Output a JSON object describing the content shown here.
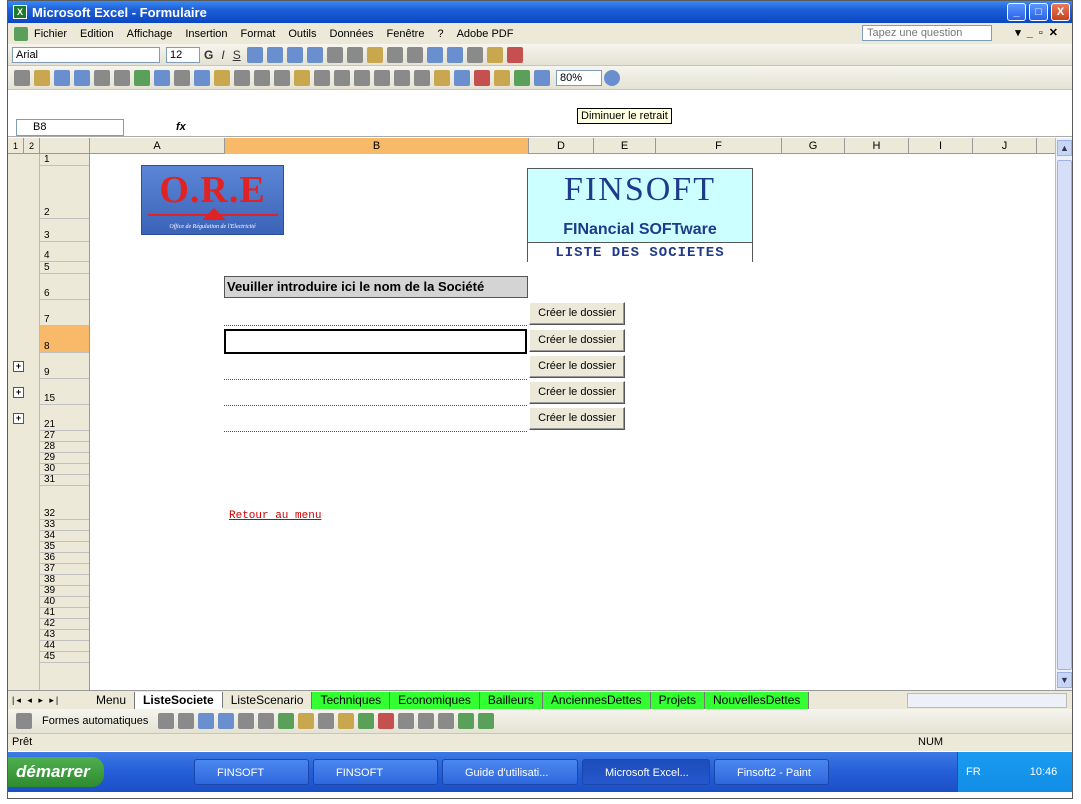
{
  "window": {
    "title": "Microsoft Excel - Formulaire",
    "min": "_",
    "max": "□",
    "close": "X"
  },
  "menu": {
    "items": [
      "Fichier",
      "Edition",
      "Affichage",
      "Insertion",
      "Format",
      "Outils",
      "Données",
      "Fenêtre",
      "?",
      "Adobe PDF"
    ],
    "question": "Tapez une question"
  },
  "format_toolbar": {
    "font": "Arial",
    "size": "12"
  },
  "std_toolbar": {
    "zoom": "80%"
  },
  "tooltip": "Diminuer le retrait",
  "formula_bar": {
    "cell": "B8",
    "fx": "fx"
  },
  "columns": [
    "A",
    "B",
    "D",
    "E",
    "F",
    "G",
    "H",
    "I",
    "J"
  ],
  "rows": [
    "1",
    "2",
    "3",
    "4",
    "5",
    "6",
    "7",
    "8",
    "9",
    "15",
    "21",
    "27",
    "28",
    "29",
    "30",
    "31",
    "32",
    "33",
    "34",
    "35",
    "36",
    "37",
    "38",
    "39",
    "40",
    "41",
    "42",
    "43",
    "44",
    "45"
  ],
  "outline": {
    "levels": [
      "1",
      "2"
    ],
    "plus": "+"
  },
  "logo": {
    "text": "O.R.E",
    "subtitle": "Office de Régulation de l'Electricité"
  },
  "finsoft": {
    "title": "FINSOFT",
    "subtitle": "FINancial SOFTware",
    "list": "LISTE DES SOCIETES"
  },
  "form": {
    "label": "Veuiller introduire ici le nom de la Société",
    "button": "Créer le dossier",
    "link": "Retour au menu"
  },
  "sheets": [
    "Menu",
    "ListeSociete",
    "ListeScenario",
    "Techniques",
    "Economiques",
    "Bailleurs",
    "AnciennesDettes",
    "Projets",
    "NouvellesDettes"
  ],
  "drawbar": {
    "shapes": "Formes automatiques"
  },
  "status": {
    "left": "Prêt",
    "num": "NUM"
  },
  "taskbar": {
    "start": "démarrer",
    "tasks": [
      "FINSOFT",
      "FINSOFT",
      "Guide d'utilisati...",
      "Microsoft Excel...",
      "Finsoft2 - Paint"
    ],
    "lang": "FR",
    "time": "10:46"
  }
}
